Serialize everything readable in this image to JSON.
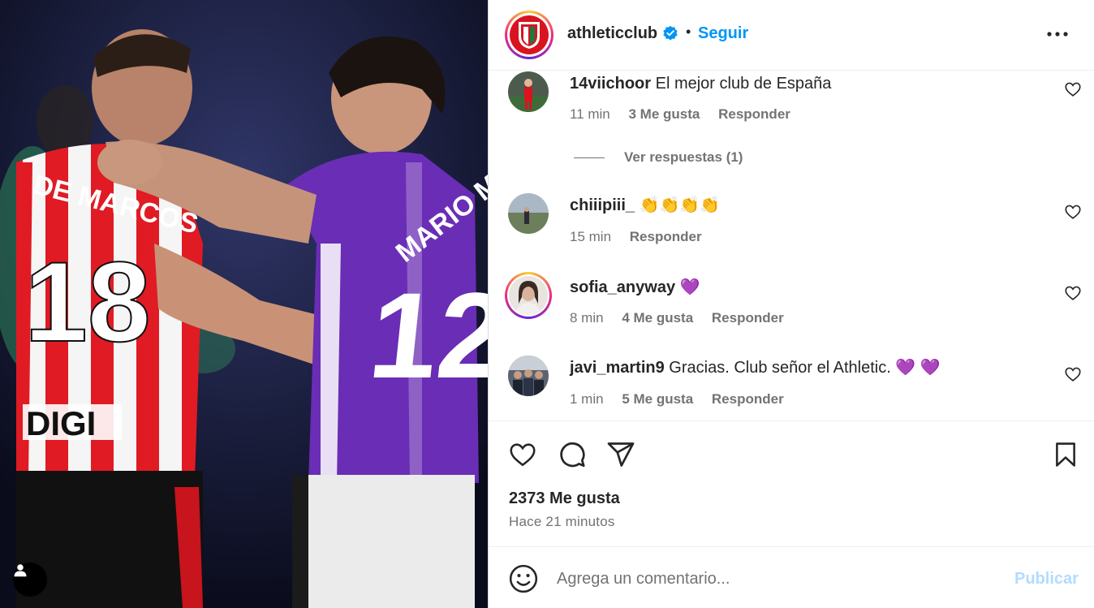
{
  "post": {
    "username": "athleticclub",
    "follow_label": "Seguir",
    "separator": "•",
    "likes": "2373 Me gusta",
    "time_ago": "Hace 21 minutos",
    "photo": {
      "left_jersey_name": "DE MARCOS",
      "left_jersey_number": "18",
      "left_sponsor": "DIGI",
      "right_jersey_name": "MARIO MA",
      "right_jersey_number": "12"
    }
  },
  "comments": [
    {
      "user": "14viichoor",
      "text": "El mejor club de España",
      "time": "11 min",
      "likes": "3 Me gusta",
      "reply": "Responder",
      "view_replies": "Ver respuestas (1)"
    },
    {
      "user": "chiiipiii_",
      "text": "👏👏👏👏",
      "time": "15 min",
      "reply": "Responder"
    },
    {
      "user": "sofia_anyway",
      "text": "💜",
      "time": "8 min",
      "likes": "4 Me gusta",
      "reply": "Responder"
    },
    {
      "user": "javi_martin9",
      "text": "Gracias. Club señor el Athletic. 💜 💜",
      "time": "1 min",
      "likes": "5 Me gusta",
      "reply": "Responder"
    }
  ],
  "compose": {
    "placeholder": "Agrega un comentario...",
    "publish_label": "Publicar"
  },
  "colors": {
    "accent": "#0095f6",
    "publish_disabled": "#b3dbff",
    "athletic_red": "#d8141f",
    "valladolid_purple": "#6a2db5"
  },
  "icons": [
    "verified-badge-icon",
    "more-options-icon",
    "heart-icon",
    "comment-icon",
    "share-icon",
    "bookmark-icon",
    "emoji-icon",
    "user-tag-icon"
  ]
}
